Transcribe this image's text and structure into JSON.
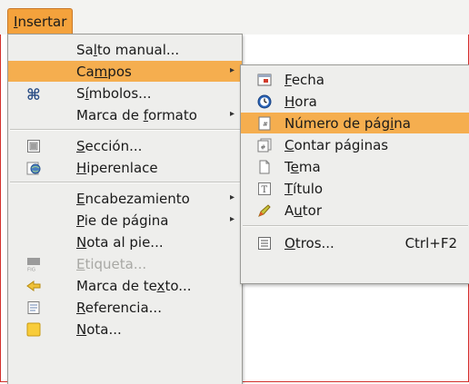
{
  "menubar": {
    "insert_menu": "Insertar"
  },
  "main_menu": [
    {
      "text": "Salto manual...",
      "u": 2
    },
    {
      "text": "Campos",
      "u": 2
    },
    {
      "text": "Símbolos...",
      "u": 1
    },
    {
      "text": "Marca de formato",
      "u": 9
    },
    {
      "text": "Sección...",
      "u": 0
    },
    {
      "text": "Hiperenlace",
      "u": 0
    },
    {
      "text": "Encabezamiento",
      "u": 0
    },
    {
      "text": "Pie de página",
      "u": 0
    },
    {
      "text": "Nota al pie...",
      "u": 0
    },
    {
      "text": "Etiqueta...",
      "u": 0
    },
    {
      "text": "Marca de texto...",
      "u": 11
    },
    {
      "text": "Referencia...",
      "u": 0
    },
    {
      "text": "Nota...",
      "u": 0
    }
  ],
  "sub_menu": [
    {
      "text": "Fecha",
      "u": 0
    },
    {
      "text": "Hora",
      "u": 0
    },
    {
      "text": "Número de página",
      "u": 13
    },
    {
      "text": "Contar páginas",
      "u": 0
    },
    {
      "text": "Tema",
      "u": 1
    },
    {
      "text": "Título",
      "u": 0
    },
    {
      "text": "Autor",
      "u": 1
    },
    {
      "text": "Otros...",
      "u": 0,
      "shortcut": "Ctrl+F2"
    }
  ],
  "colors": {
    "highlight": "#f5ae4f",
    "menubar_active": "#f4a23c",
    "disabled": "#a8a8a4"
  }
}
